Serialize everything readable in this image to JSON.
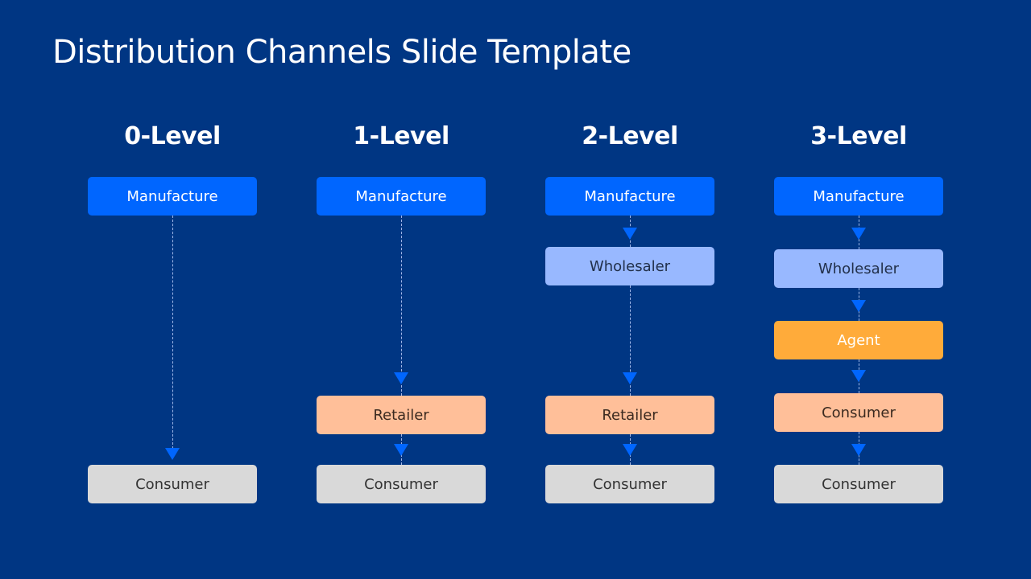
{
  "slide": {
    "title": "Distribution Channels Slide Template",
    "colors": {
      "background": "#003683",
      "manufacture": "#0066ff",
      "wholesaler": "#98b8ff",
      "agent": "#ffab3a",
      "retailer": "#ffbf99",
      "consumer": "#d9d9d9"
    },
    "columns": [
      {
        "heading": "0-Level",
        "nodes": [
          "Manufacture",
          "Consumer"
        ]
      },
      {
        "heading": "1-Level",
        "nodes": [
          "Manufacture",
          "Retailer",
          "Consumer"
        ]
      },
      {
        "heading": "2-Level",
        "nodes": [
          "Manufacture",
          "Wholesaler",
          "Retailer",
          "Consumer"
        ]
      },
      {
        "heading": "3-Level",
        "nodes": [
          "Manufacture",
          "Wholesaler",
          "Agent",
          "Consumer",
          "Consumer"
        ]
      }
    ]
  }
}
